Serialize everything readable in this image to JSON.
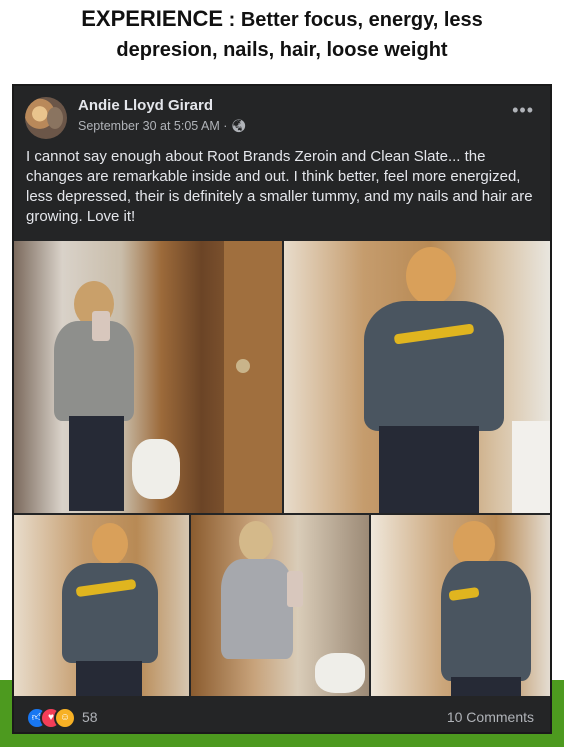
{
  "headline": {
    "title": "EXPERIENCE",
    "rest": " : Better focus, energy, less",
    "line2": "depresion,  nails, hair, loose weight"
  },
  "post": {
    "author": "Andie Lloyd Girard",
    "timestamp": "September 30 at 5:05 AM · ",
    "audience_icon": "globe-icon",
    "more_label": "•••",
    "text": "I cannot say enough about Root Brands Zeroin and Clean Slate... the changes are remarkable inside and out.  I think better, feel more energized, less depressed, their is definitely a smaller tummy, and my nails and hair are growing.   Love it!",
    "reaction_count": "58",
    "comments_label": "10 Comments",
    "reaction_icons": [
      "like-icon",
      "love-icon",
      "care-icon"
    ]
  },
  "colors": {
    "post_bg": "#242526",
    "text": "#e4e6eb",
    "muted": "#b0b3b8",
    "green_band": "#4d9a1f"
  }
}
